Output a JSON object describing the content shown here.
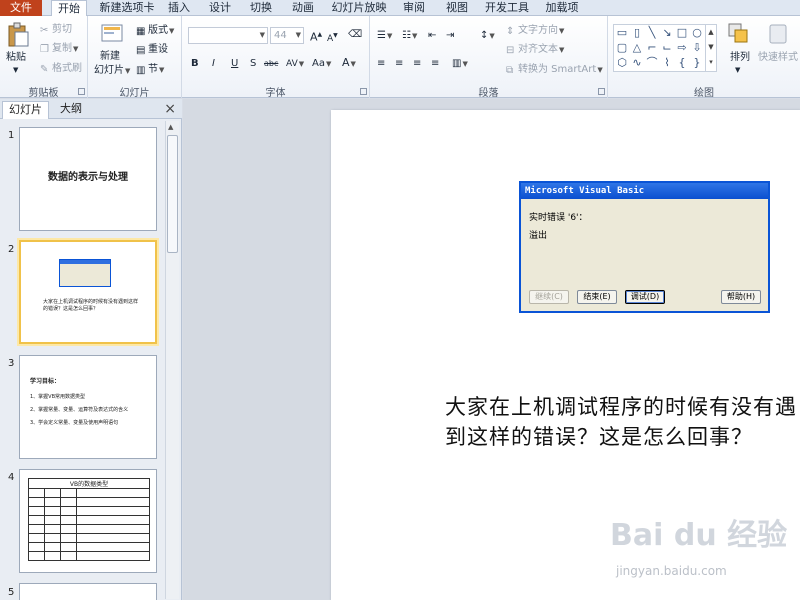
{
  "ribbon_tabs": [
    "文件",
    "开始",
    "新建选项卡",
    "插入",
    "设计",
    "切换",
    "动画",
    "幻灯片放映",
    "审阅",
    "视图",
    "开发工具",
    "加载项"
  ],
  "clipboard": {
    "paste": "粘贴",
    "cut": "剪切",
    "copy": "复制",
    "format_painter": "格式刷",
    "label": "剪贴板"
  },
  "slides_group": {
    "new_slide": "新建",
    "new_slide2": "幻灯片",
    "layout": "版式",
    "reset": "重设",
    "section": "节",
    "label": "幻灯片"
  },
  "font_group": {
    "font_size": "44",
    "bold": "B",
    "italic": "I",
    "underline": "U",
    "shadow": "S",
    "strike": "abc",
    "spacing": "AV",
    "case": "Aa",
    "color": "A",
    "grow": "A",
    "shrink": "A",
    "label": "字体"
  },
  "paragraph_group": {
    "text_direction": "文字方向",
    "align_text": "对齐文本",
    "smartart": "转换为 SmartArt",
    "label": "段落"
  },
  "drawing_group": {
    "arrange": "排列",
    "quick_styles": "快速样式",
    "label": "绘图"
  },
  "pane": {
    "tab_slides": "幻灯片",
    "tab_outline": "大纲",
    "close": "×"
  },
  "thumbnails": [
    {
      "num": "1",
      "title": "数据的表示与处理"
    },
    {
      "num": "2",
      "text": "大家在上机调试程序的时候有没有遇到这样的错误？这是怎么回事？"
    },
    {
      "num": "3",
      "heading": "学习目标：",
      "items": [
        "1、掌握VB常用数据类型",
        "2、掌握常量、变量、运算符及表达式的含义",
        "3、学会定义常量、变量及使用声明语句"
      ]
    },
    {
      "num": "4",
      "table_title": "VB的数据类型"
    },
    {
      "num": "5"
    }
  ],
  "dialog": {
    "title": "Microsoft Visual Basic",
    "message": "实时错误 '6'：",
    "detail": "溢出",
    "buttons": {
      "continue": "继续(C)",
      "end": "结束(E)",
      "debug": "调试(D)",
      "help": "帮助(H)"
    }
  },
  "slide_text": "大家在上机调试程序的时候有没有遇到这样的错误？这是怎么回事？",
  "watermark": {
    "logo": "Bai du 经验",
    "url": "jingyan.baidu.com"
  }
}
